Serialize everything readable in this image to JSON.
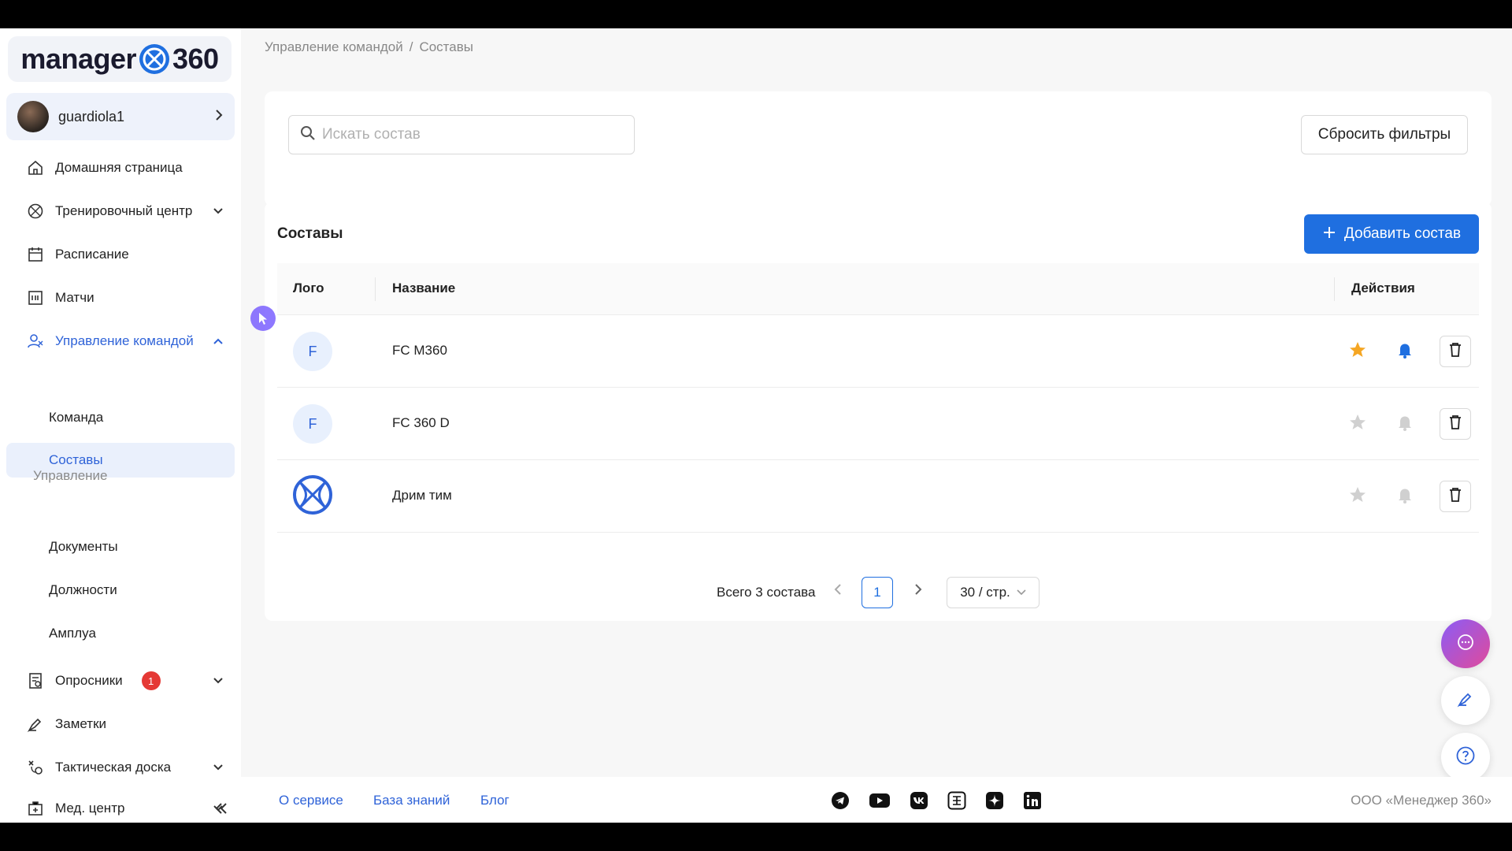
{
  "brand": {
    "logo_text_left": "manager",
    "logo_text_right": "360"
  },
  "user": {
    "name": "guardiola1"
  },
  "sidebar": {
    "items": [
      {
        "label": "Домашняя страница"
      },
      {
        "label": "Тренировочный центр"
      },
      {
        "label": "Расписание"
      },
      {
        "label": "Матчи"
      },
      {
        "label": "Управление командой"
      }
    ],
    "team_sub": [
      {
        "label": "Команда"
      },
      {
        "label": "Составы"
      }
    ],
    "group_label": "Управление",
    "manage_sub": [
      {
        "label": "Документы"
      },
      {
        "label": "Должности"
      },
      {
        "label": "Амплуа"
      }
    ],
    "bottom_items": [
      {
        "label": "Опросники",
        "badge": "1"
      },
      {
        "label": "Заметки"
      },
      {
        "label": "Тактическая доска"
      },
      {
        "label": "Мед. центр"
      }
    ]
  },
  "breadcrumb": {
    "parent": "Управление командой",
    "separator": "/",
    "current": "Составы"
  },
  "filters": {
    "search_placeholder": "Искать состав",
    "reset_label": "Сбросить фильтры"
  },
  "rosters": {
    "title": "Составы",
    "add_label": "Добавить состав",
    "columns": {
      "logo": "Лого",
      "name": "Название",
      "actions": "Действия"
    },
    "rows": [
      {
        "logo_letter": "F",
        "name": "FC M360",
        "favorite": true,
        "notify": true
      },
      {
        "logo_letter": "F",
        "name": "FC 360 D",
        "favorite": false,
        "notify": false
      },
      {
        "logo_letter": "",
        "name": "Дрим тим",
        "favorite": false,
        "notify": false
      }
    ]
  },
  "pagination": {
    "total": "Всего 3 состава",
    "page": "1",
    "page_size": "30 / стр."
  },
  "footer": {
    "about": "О сервисе",
    "knowledge": "База знаний",
    "blog": "Блог",
    "company": "ООО «Менеджер 360»"
  },
  "colors": {
    "accent": "#1f6fe0",
    "star_active": "#f5a623",
    "bell_active": "#1f6fe0",
    "inactive_icon": "#d0d0d0",
    "badge": "#e53935"
  }
}
